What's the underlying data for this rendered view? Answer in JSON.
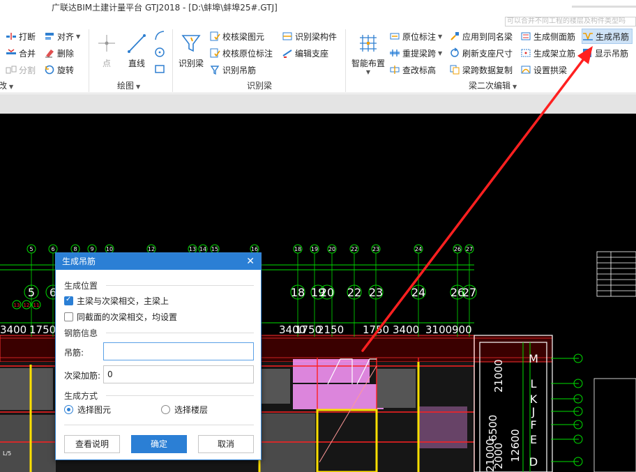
{
  "window": {
    "title": "广联达BIM土建计量平台 GTJ2018 - [D:\\蚌埠\\蚌埠25#.GTJ]",
    "search_hint": "可以合并不同工程的楼层及构件类型吗"
  },
  "ribbon": {
    "modify": {
      "label": "修改",
      "items": [
        "打断",
        "合并",
        "分割",
        "对齐",
        "删除",
        "旋转"
      ]
    },
    "draw": {
      "label": "绘图",
      "items": [
        "点",
        "直线"
      ]
    },
    "recognize": {
      "label": "识别梁",
      "big": "识别梁",
      "items": [
        "校核梁图元",
        "校核原位标注",
        "识别吊筋",
        "识别梁构件",
        "编辑支座"
      ]
    },
    "edit": {
      "label": "梁二次编辑",
      "big": "智能布置",
      "col1": [
        "原位标注",
        "重提梁跨",
        "查改标高"
      ],
      "col2": [
        "应用到同名梁",
        "刷新支座尺寸",
        "梁跨数据复制"
      ],
      "col3": [
        "生成侧面筋",
        "生成架立筋",
        "设置拱梁"
      ],
      "col4": [
        "生成吊筋",
        "显示吊筋"
      ]
    }
  },
  "cad": {
    "axis_top": [
      "5",
      "6",
      "8",
      "9",
      "10",
      "12",
      "13",
      "14",
      "15",
      "16",
      "18",
      "19",
      "20",
      "22",
      "23",
      "24",
      "26",
      "27"
    ],
    "axis_big": [
      "5",
      "6",
      "18",
      "19",
      "20",
      "22",
      "23",
      "24",
      "26",
      "27"
    ],
    "dims": [
      "3400",
      "1750",
      "3400",
      "1750",
      "2150",
      "1750",
      "3400",
      "3100",
      "900"
    ],
    "row_letters": [
      "M",
      "L",
      "K",
      "J",
      "F",
      "E",
      "D"
    ],
    "vert_dims": [
      "21000",
      "12600",
      "2000",
      "21000",
      "6500"
    ],
    "small_left": [
      "13",
      "12",
      "11"
    ]
  },
  "dialog": {
    "title": "生成吊筋",
    "section_position": "生成位置",
    "opt_main": "主梁与次梁相交，主梁上",
    "opt_main_checked": true,
    "opt_same": "同截面的次梁相交，均设置",
    "opt_same_checked": false,
    "section_rebar": "钢筋信息",
    "hanger_label": "吊筋:",
    "hanger_value": "",
    "secondary_label": "次梁加筋:",
    "secondary_value": "0",
    "section_mode": "生成方式",
    "mode_element": "选择图元",
    "mode_floor": "选择楼层",
    "mode_selected": "选择图元",
    "btn_help": "查看说明",
    "btn_ok": "确定",
    "btn_cancel": "取消"
  },
  "colors": {
    "accent": "#2b7fd5",
    "annotation_arrow": "#ff2020",
    "cad_green": "#00ff00",
    "cad_red": "#ff0000",
    "cad_pink": "#ff99ff"
  }
}
